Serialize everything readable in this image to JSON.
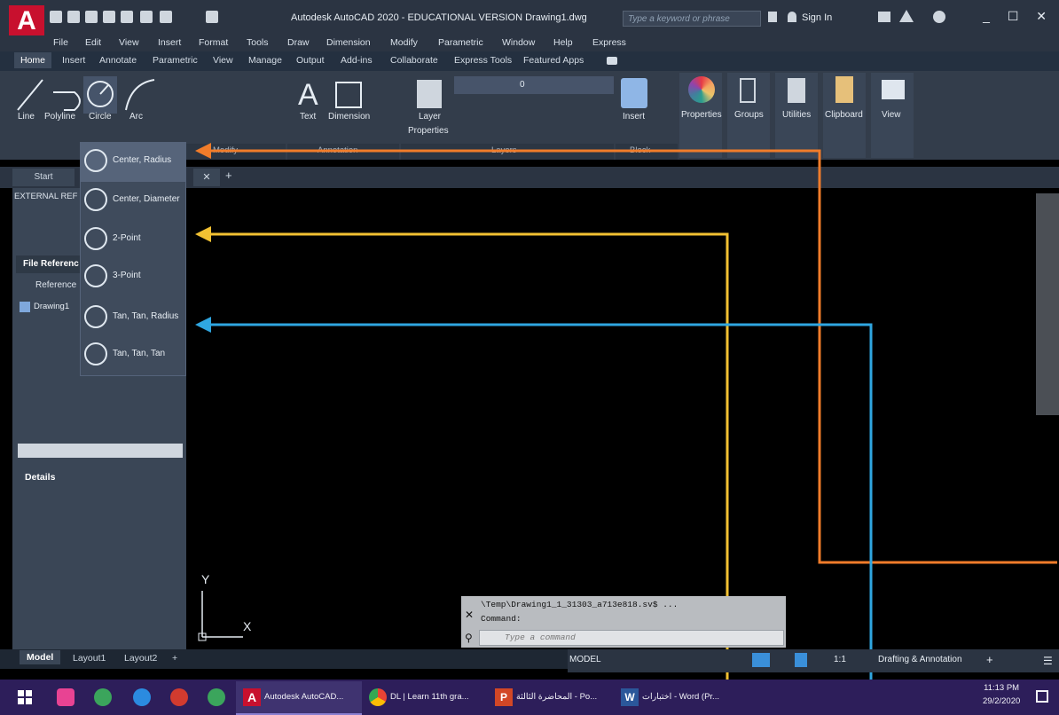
{
  "titlebar": {
    "logo": "A",
    "title": "Autodesk AutoCAD 2020 - EDUCATIONAL VERSION    Drawing1.dwg",
    "search_placeholder": "Type a keyword or phrase",
    "sign_in": "Sign In",
    "window_controls": "_ ☐ ✕"
  },
  "menubar": [
    "File",
    "Edit",
    "View",
    "Insert",
    "Format",
    "Tools",
    "Draw",
    "Dimension",
    "Modify",
    "Parametric",
    "Window",
    "Help",
    "Express"
  ],
  "ribbon_tabs": [
    "Home",
    "Insert",
    "Annotate",
    "Parametric",
    "View",
    "Manage",
    "Output",
    "Add-ins",
    "Collaborate",
    "Express Tools",
    "Featured Apps"
  ],
  "ribbon": {
    "draw_tools": [
      "Line",
      "Polyline",
      "Circle",
      "Arc"
    ],
    "annotation_tools": [
      "Text",
      "Dimension"
    ],
    "layer_tool": [
      "Layer",
      "Properties"
    ],
    "layer_value": "0",
    "insert_tool": "Insert",
    "right_tools": [
      "Properties",
      "Groups",
      "Utilities",
      "Clipboard",
      "View"
    ],
    "panel_titles": [
      "Modify",
      "Annotation",
      "Layers",
      "Block"
    ]
  },
  "file_tabs": {
    "start": "Start"
  },
  "palette": {
    "title": "EXTERNAL REF",
    "section": "File Referenc",
    "column": "Reference",
    "item": "Drawing1",
    "details": "Details"
  },
  "circle_dropdown": [
    "Center, Radius",
    "Center, Diameter",
    "2-Point",
    "3-Point",
    "Tan, Tan, Radius",
    "Tan, Tan, Tan"
  ],
  "axes": {
    "y": "Y",
    "x": "X"
  },
  "command_line": {
    "history_1": "\\Temp\\Drawing1_1_31303_a713e818.sv$ ...",
    "history_2": "Command:",
    "placeholder": "Type a command"
  },
  "layout_tabs": [
    "Model",
    "Layout1",
    "Layout2"
  ],
  "status_bar": {
    "model": "MODEL",
    "scale": "1:1",
    "workspace": "Drafting & Annotation"
  },
  "taskbar": {
    "apps": [
      "Autodesk AutoCAD...",
      "DL | Learn 11th gra...",
      "المحاضرة الثالثة - Po...",
      "اختبارات - Word (Pr..."
    ],
    "time": "11:13 PM",
    "date": "29/2/2020"
  },
  "colors": {
    "orange_arrow": "#f07c2a",
    "yellow_arrow": "#f2c132",
    "blue_arrow": "#2fa6e0",
    "autocad_red": "#c8102e"
  }
}
